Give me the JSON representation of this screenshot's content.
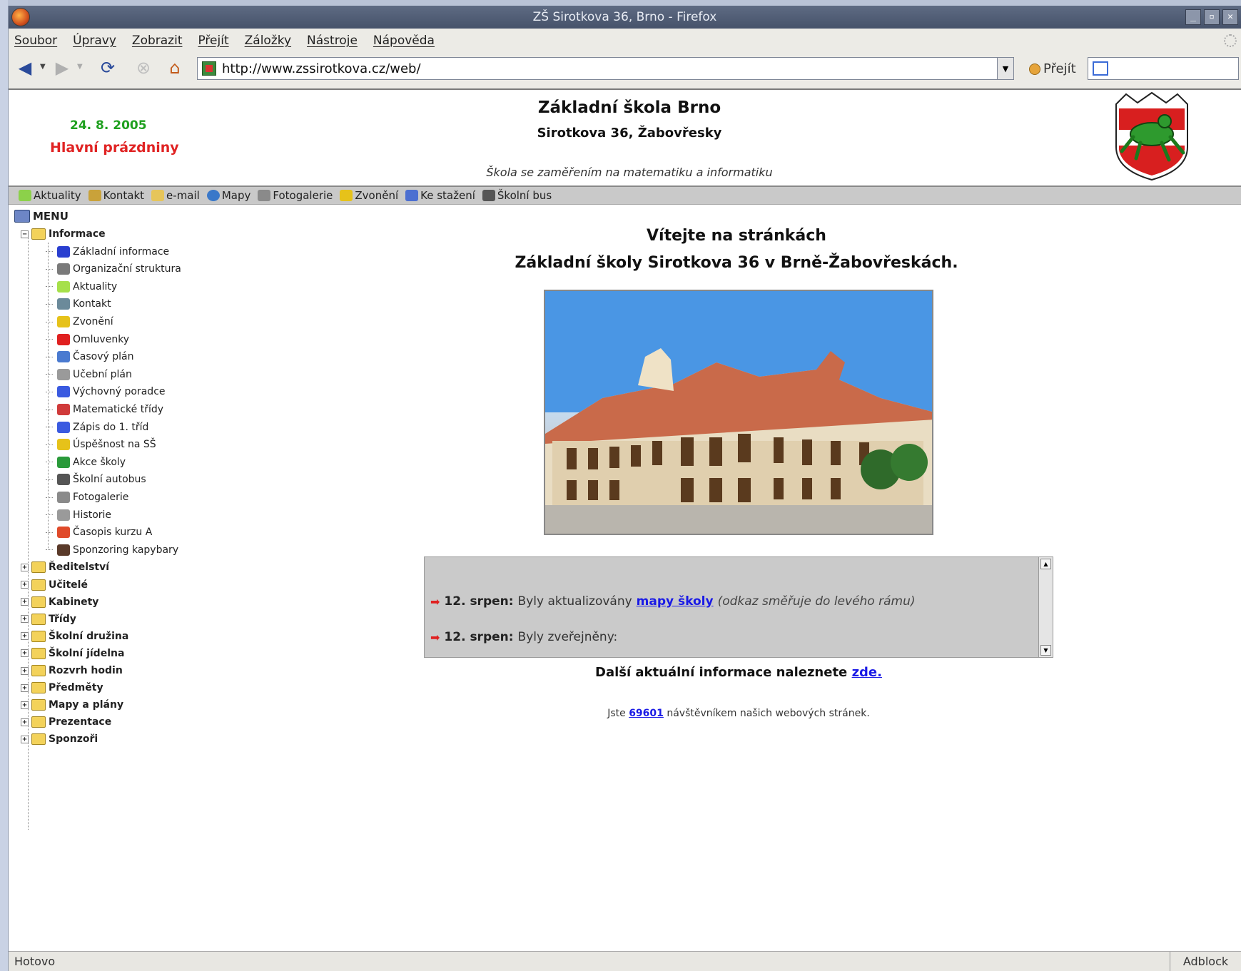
{
  "window": {
    "title": "ZŠ Sirotkova 36, Brno - Firefox"
  },
  "menubar": {
    "items": [
      "Soubor",
      "Úpravy",
      "Zobrazit",
      "Přejít",
      "Záložky",
      "Nástroje",
      "Nápověda"
    ]
  },
  "navbar": {
    "url": "http://www.zssirotkova.cz/web/",
    "go_label": "Přejít",
    "search_placeholder": ""
  },
  "header": {
    "date": "24. 8. 2005",
    "holiday": "Hlavní prázdniny",
    "title": "Základní škola Brno",
    "subtitle": "Sirotkova 36, Žabovřesky",
    "motto": "Škola se zaměřením na matematiku a informatiku"
  },
  "quickbar": {
    "items": [
      {
        "label": "Aktuality",
        "color": "#8cd14a"
      },
      {
        "label": "Kontakt",
        "color": "#c9a23a"
      },
      {
        "label": "e-mail",
        "color": "#e6c55a"
      },
      {
        "label": "Mapy",
        "color": "#3a78c9"
      },
      {
        "label": "Fotogalerie",
        "color": "#8a8a8a"
      },
      {
        "label": "Zvonění",
        "color": "#e6c21a"
      },
      {
        "label": "Ke stažení",
        "color": "#4c6fd1"
      },
      {
        "label": "Školní bus",
        "color": "#555555"
      }
    ]
  },
  "tree": {
    "root": "MENU",
    "open_folder": "Informace",
    "leaves": [
      {
        "label": "Základní informace",
        "color": "#2a3fd0"
      },
      {
        "label": "Organizační struktura",
        "color": "#7a7a7a"
      },
      {
        "label": "Aktuality",
        "color": "#a6e04a"
      },
      {
        "label": "Kontakt",
        "color": "#6b8a9a"
      },
      {
        "label": "Zvonění",
        "color": "#e6c21a"
      },
      {
        "label": "Omluvenky",
        "color": "#e02020"
      },
      {
        "label": "Časový plán",
        "color": "#4a7ad0"
      },
      {
        "label": "Učební plán",
        "color": "#9a9a9a"
      },
      {
        "label": "Výchovný poradce",
        "color": "#3a5ae0"
      },
      {
        "label": "Matematické třídy",
        "color": "#d03a3a"
      },
      {
        "label": "Zápis do 1. tříd",
        "color": "#3a5ae0"
      },
      {
        "label": "Úspěšnost na SŠ",
        "color": "#e6c21a"
      },
      {
        "label": "Akce školy",
        "color": "#2a9a3a"
      },
      {
        "label": "Školní autobus",
        "color": "#555555"
      },
      {
        "label": "Fotogalerie",
        "color": "#8a8a8a"
      },
      {
        "label": "Historie",
        "color": "#9a9a9a"
      },
      {
        "label": "Časopis kurzu A",
        "color": "#e04a2a"
      },
      {
        "label": "Sponzoring kapybary",
        "color": "#5a3a2a"
      }
    ],
    "folders": [
      "Ředitelství",
      "Učitelé",
      "Kabinety",
      "Třídy",
      "Školní družina",
      "Školní jídelna",
      "Rozvrh hodin",
      "Předměty",
      "Mapy a plány",
      "Prezentace",
      "Sponzoři"
    ]
  },
  "main": {
    "welcome1": "Vítejte na stránkách",
    "welcome2": "Základní školy Sirotkova 36 v Brně-Žabovřeskách.",
    "news": [
      {
        "date": "12. srpen:",
        "text": "Byly aktualizovány",
        "link": "mapy školy",
        "note": "(odkaz směřuje do levého rámu)"
      },
      {
        "date": "12. srpen:",
        "text": "Byly zveřejněny:",
        "link": "",
        "note": ""
      }
    ],
    "more_info_text": "Další aktuální informace naleznete",
    "more_info_link": "zde.",
    "counter_prefix": "Jste",
    "counter_value": "69601",
    "counter_suffix": "návštěvníkem našich webových stránek."
  },
  "statusbar": {
    "status": "Hotovo",
    "adblock": "Adblock"
  }
}
